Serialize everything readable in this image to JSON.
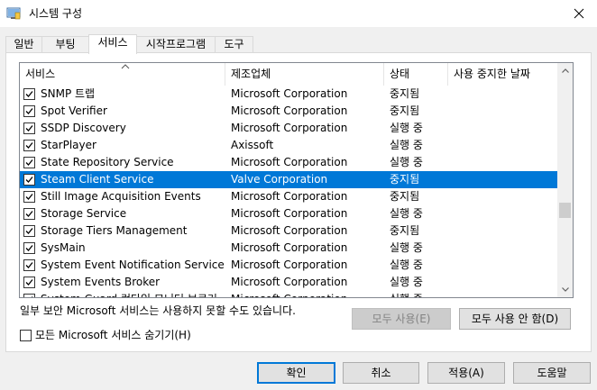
{
  "window": {
    "title": "시스템 구성"
  },
  "tabs": [
    {
      "label": "일반"
    },
    {
      "label": "부팅"
    },
    {
      "label": "서비스"
    },
    {
      "label": "시작프로그램"
    },
    {
      "label": "도구"
    }
  ],
  "active_tab": "서비스",
  "list": {
    "columns": [
      "서비스",
      "제조업체",
      "상태",
      "사용 중지한 날짜"
    ],
    "rows": [
      {
        "name": "SNMP 트랩",
        "manufacturer": "Microsoft Corporation",
        "status": "중지됨",
        "checked": true
      },
      {
        "name": "Spot Verifier",
        "manufacturer": "Microsoft Corporation",
        "status": "중지됨",
        "checked": true
      },
      {
        "name": "SSDP Discovery",
        "manufacturer": "Microsoft Corporation",
        "status": "실행 중",
        "checked": true
      },
      {
        "name": "StarPlayer",
        "manufacturer": "Axissoft",
        "status": "실행 중",
        "checked": true
      },
      {
        "name": "State Repository Service",
        "manufacturer": "Microsoft Corporation",
        "status": "실행 중",
        "checked": true
      },
      {
        "name": "Steam Client Service",
        "manufacturer": "Valve Corporation",
        "status": "중지됨",
        "checked": true,
        "selected": true
      },
      {
        "name": "Still Image Acquisition Events",
        "manufacturer": "Microsoft Corporation",
        "status": "중지됨",
        "checked": true
      },
      {
        "name": "Storage Service",
        "manufacturer": "Microsoft Corporation",
        "status": "실행 중",
        "checked": true
      },
      {
        "name": "Storage Tiers Management",
        "manufacturer": "Microsoft Corporation",
        "status": "중지됨",
        "checked": true
      },
      {
        "name": "SysMain",
        "manufacturer": "Microsoft Corporation",
        "status": "실행 중",
        "checked": true
      },
      {
        "name": "System Event Notification Service",
        "manufacturer": "Microsoft Corporation",
        "status": "실행 중",
        "checked": true
      },
      {
        "name": "System Events Broker",
        "manufacturer": "Microsoft Corporation",
        "status": "실행 중",
        "checked": true
      },
      {
        "name": "System Guard 런타임 모니터 브로커",
        "manufacturer": "Microsoft Corporation",
        "status": "실행 중",
        "checked": true
      }
    ]
  },
  "note": "일부 보안 Microsoft 서비스는 사용하지 못할 수도 있습니다.",
  "buttons": {
    "enable_all": "모두 사용(E)",
    "disable_all": "모두 사용 안 함(D)",
    "ok": "확인",
    "cancel": "취소",
    "apply": "적용(A)",
    "help": "도움말"
  },
  "hide_ms": {
    "label": "모든 Microsoft 서비스 숨기기(H)",
    "checked": false
  },
  "colors": {
    "selection": "#0078d7",
    "accent": "#0078d7"
  }
}
